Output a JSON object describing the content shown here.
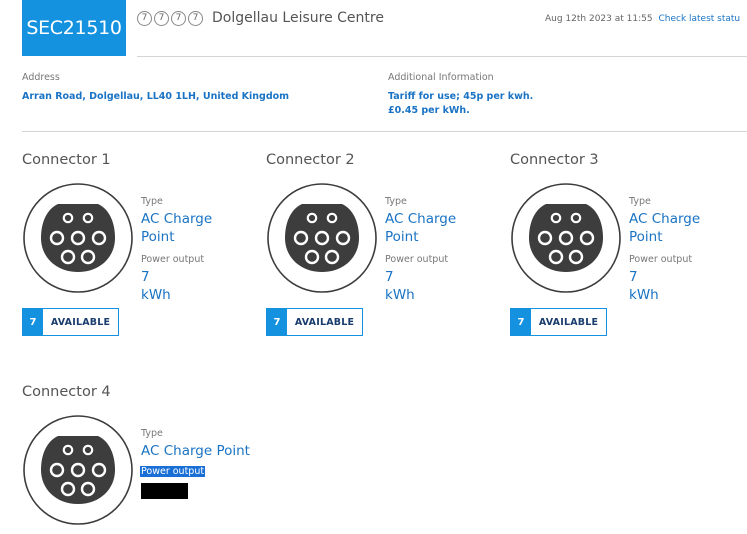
{
  "header": {
    "site_id": "SEC21510",
    "rating_glyph": "7",
    "site_name": "Dolgellau Leisure Centre",
    "timestamp": "Aug 12th 2023 at 11:55",
    "check_status_link": "Check latest statu"
  },
  "info": {
    "address_label": "Address",
    "address_value": "Arran Road, Dolgellau, LL40 1LH, United Kingdom",
    "additional_label": "Additional Information",
    "additional_line1": "Tariff for use; 45p per kwh.",
    "additional_line2": "£0.45 per kWh."
  },
  "connectors": [
    {
      "title": "Connector 1",
      "type_label": "Type",
      "type_value": "AC Charge Point",
      "power_label": "Power output",
      "power_value": "7 kWh",
      "status_num": "7",
      "status_text": "AVAILABLE"
    },
    {
      "title": "Connector 2",
      "type_label": "Type",
      "type_value": "AC Charge Point",
      "power_label": "Power output",
      "power_value": "7 kWh",
      "status_num": "7",
      "status_text": "AVAILABLE"
    },
    {
      "title": "Connector 3",
      "type_label": "Type",
      "type_value": "AC Charge Point",
      "power_label": "Power output",
      "power_value": "7 kWh",
      "status_num": "7",
      "status_text": "AVAILABLE"
    },
    {
      "title": "Connector 4",
      "type_label": "Type",
      "type_value": "AC Charge Point",
      "power_label": "Power output"
    }
  ],
  "colors": {
    "accent": "#1492e0",
    "link": "#1a73c4",
    "status_text": "#1a3c6e",
    "plug_face": "#3d3d3d"
  }
}
